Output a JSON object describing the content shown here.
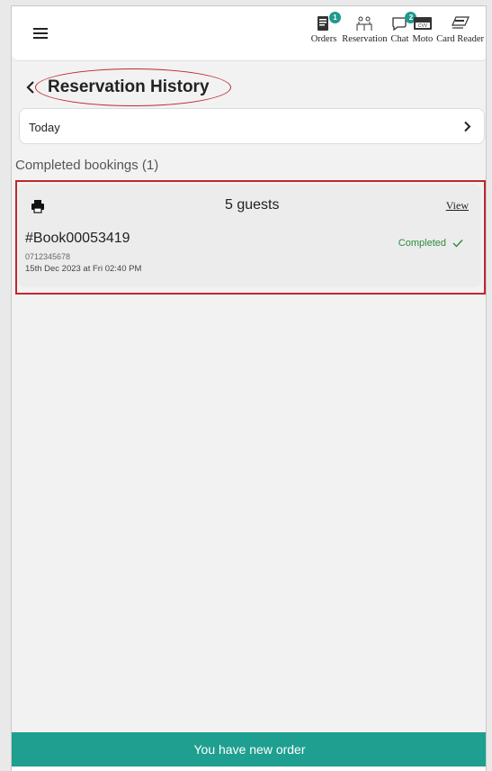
{
  "header": {
    "nav": [
      {
        "icon": "orders-icon",
        "label": "Orders",
        "badge": "1"
      },
      {
        "icon": "reservation-icon",
        "label": "Reservation",
        "badge": ""
      },
      {
        "icon": "chat-icon",
        "label": "Chat",
        "badge": "2"
      },
      {
        "icon": "moto-icon",
        "label": "Moto",
        "badge": "",
        "glyph_text": "CVV"
      },
      {
        "icon": "card-reader-icon",
        "label": "Card Reader",
        "badge": ""
      }
    ]
  },
  "page": {
    "title": "Reservation History"
  },
  "filter": {
    "date_label": "Today"
  },
  "section": {
    "label": "Completed bookings (1)"
  },
  "booking": {
    "guests": "5 guests",
    "view_label": "View",
    "id": "#Book00053419",
    "phone": "0712345678",
    "datetime": "15th Dec 2023 at Fri 02:40 PM",
    "status": "Completed"
  },
  "banner": {
    "text": "You have new order"
  },
  "colors": {
    "accent": "#1f9f8f",
    "highlight": "#c0272d",
    "status_green": "#2e8b3e"
  }
}
